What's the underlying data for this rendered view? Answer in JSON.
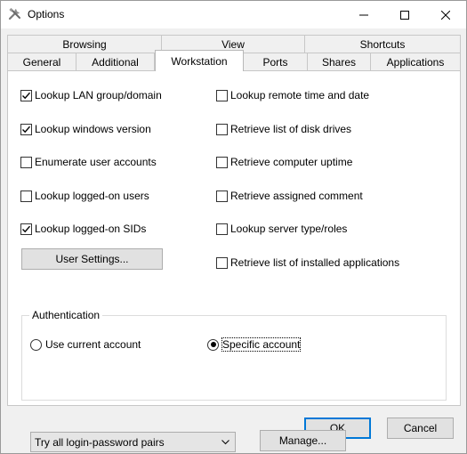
{
  "window": {
    "title": "Options"
  },
  "tabs": {
    "row_top": [
      {
        "label": "Browsing"
      },
      {
        "label": "View"
      },
      {
        "label": "Shortcuts"
      }
    ],
    "row_bottom": [
      {
        "label": "General"
      },
      {
        "label": "Additional"
      },
      {
        "label": "Workstation",
        "selected": true
      },
      {
        "label": "Ports"
      },
      {
        "label": "Shares"
      },
      {
        "label": "Applications"
      }
    ]
  },
  "workstation": {
    "left_options": [
      {
        "label": "Lookup LAN group/domain",
        "checked": true
      },
      {
        "label": "Lookup windows version",
        "checked": true
      },
      {
        "label": "Enumerate user accounts",
        "checked": false
      },
      {
        "label": "Lookup logged-on users",
        "checked": false
      },
      {
        "label": "Lookup logged-on SIDs",
        "checked": true
      }
    ],
    "right_options": [
      {
        "label": "Lookup remote time and date",
        "checked": false
      },
      {
        "label": "Retrieve list of disk drives",
        "checked": false
      },
      {
        "label": "Retrieve computer uptime",
        "checked": false
      },
      {
        "label": "Retrieve assigned comment",
        "checked": false
      },
      {
        "label": "Lookup server type/roles",
        "checked": false
      },
      {
        "label": "Retrieve list of installed applications",
        "checked": false
      }
    ],
    "user_settings_label": "User Settings..."
  },
  "authentication": {
    "group_label": "Authentication",
    "use_current_label": "Use current account",
    "specific_label": "Specific account",
    "selected": "specific",
    "login_pairs_value": "Try all login-password pairs",
    "manage_label": "Manage..."
  },
  "footer": {
    "ok_label": "OK",
    "cancel_label": "Cancel"
  }
}
